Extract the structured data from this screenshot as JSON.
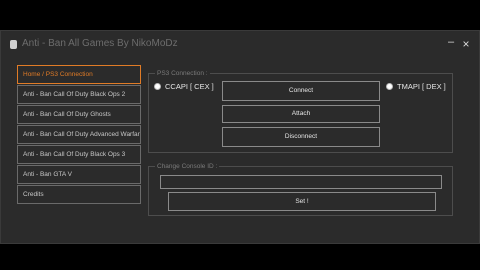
{
  "window": {
    "title": "Anti - Ban All Games By NikoMoDz",
    "minimize_symbol": "–",
    "close_symbol": "×"
  },
  "sidebar": {
    "items": [
      {
        "label": "Home / PS3 Connection",
        "active": true
      },
      {
        "label": "Anti - Ban Call Of Duty Black Ops 2"
      },
      {
        "label": "Anti - Ban Call Of Duty Ghosts"
      },
      {
        "label": "Anti - Ban Call Of Duty Advanced Warfare"
      },
      {
        "label": "Anti - Ban Call Of Duty Black Ops 3"
      },
      {
        "label": "Anti - Ban GTA V"
      },
      {
        "label": "Credits"
      }
    ]
  },
  "ps3_connection": {
    "legend": "PS3 Connection :",
    "radio_ccapi": "CCAPI [ CEX ]",
    "radio_tmapi": "TMAPI [ DEX ]",
    "connect_label": "Connect",
    "attach_label": "Attach",
    "disconnect_label": "Disconnect"
  },
  "change_console_id": {
    "legend": "Change Console ID :",
    "input_value": "",
    "set_label": "Set !"
  },
  "colors": {
    "accent": "#e07b26",
    "window_bg": "#2b2b2b",
    "border": "#6a6a6a"
  }
}
